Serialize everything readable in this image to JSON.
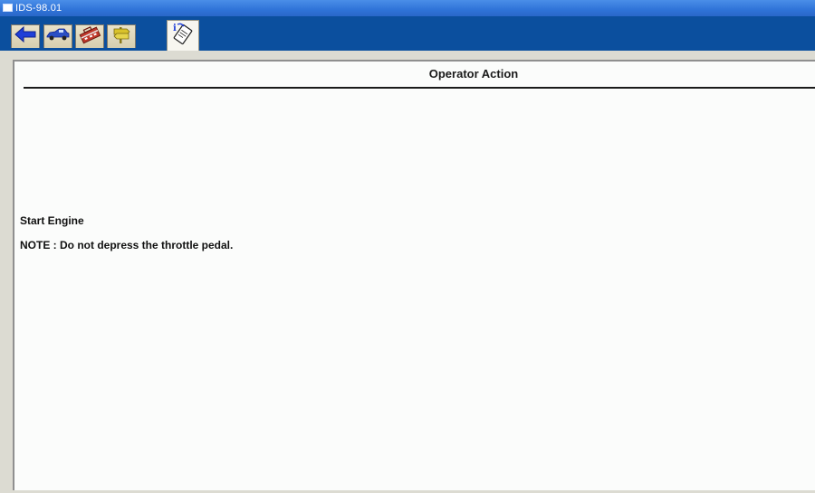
{
  "window": {
    "title": "IDS-98.01"
  },
  "toolbar": {
    "tabs": [
      {
        "icon": "back-arrow-icon",
        "label": "Back"
      },
      {
        "icon": "vehicle-icon",
        "label": "Vehicle"
      },
      {
        "icon": "toolbox-icon",
        "label": "Toolbox"
      },
      {
        "icon": "signpost-icon",
        "label": "Navigation"
      },
      {
        "icon": "info-icon",
        "label": "Info"
      }
    ],
    "active_tab": "info"
  },
  "panel": {
    "header": "Operator Action",
    "instructions": [
      "Start Engine",
      "NOTE : Do not depress the throttle pedal."
    ]
  },
  "colors": {
    "window_bg": "#0b4f9e",
    "titlebar": "#2f73d8",
    "panel_bg": "#fbfcfb",
    "tab_bg": "#d6ceb0",
    "back_arrow": "#1f3fd8",
    "toolbox_red": "#c0392b",
    "signpost_yellow": "#d9c22a"
  }
}
